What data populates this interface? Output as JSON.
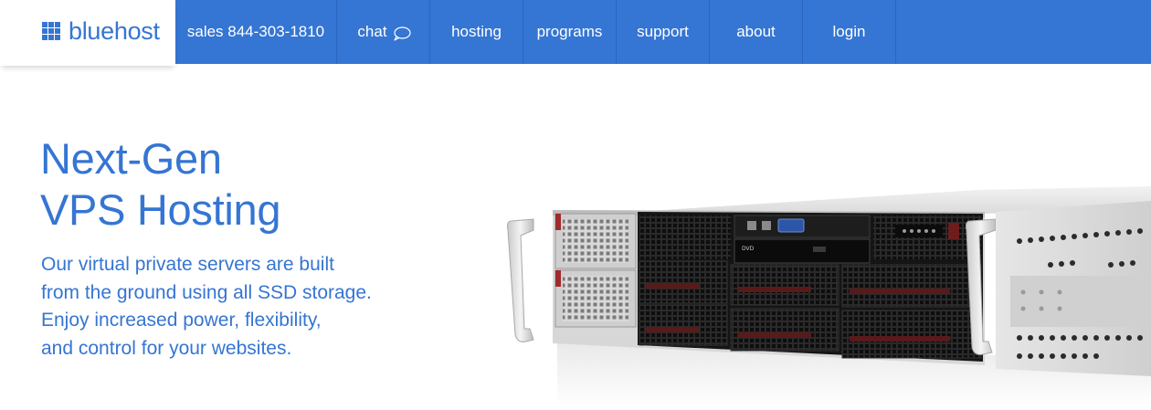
{
  "brand": {
    "name": "bluehost",
    "color": "#3575d3"
  },
  "nav": {
    "sales": "sales 844-303-1810",
    "chat": "chat",
    "hosting": "hosting",
    "programs": "programs",
    "support": "support",
    "about": "about",
    "login": "login"
  },
  "hero": {
    "headline_line1": "Next-Gen",
    "headline_line2": "VPS Hosting",
    "sub_line1": "Our virtual private servers are built",
    "sub_line2": "from the ground using all SSD storage.",
    "sub_line3": "Enjoy increased power, flexibility,",
    "sub_line4": "and control for your websites."
  },
  "server_image": {
    "icon": "rack-server-illustration",
    "drive_label": "DVD"
  }
}
